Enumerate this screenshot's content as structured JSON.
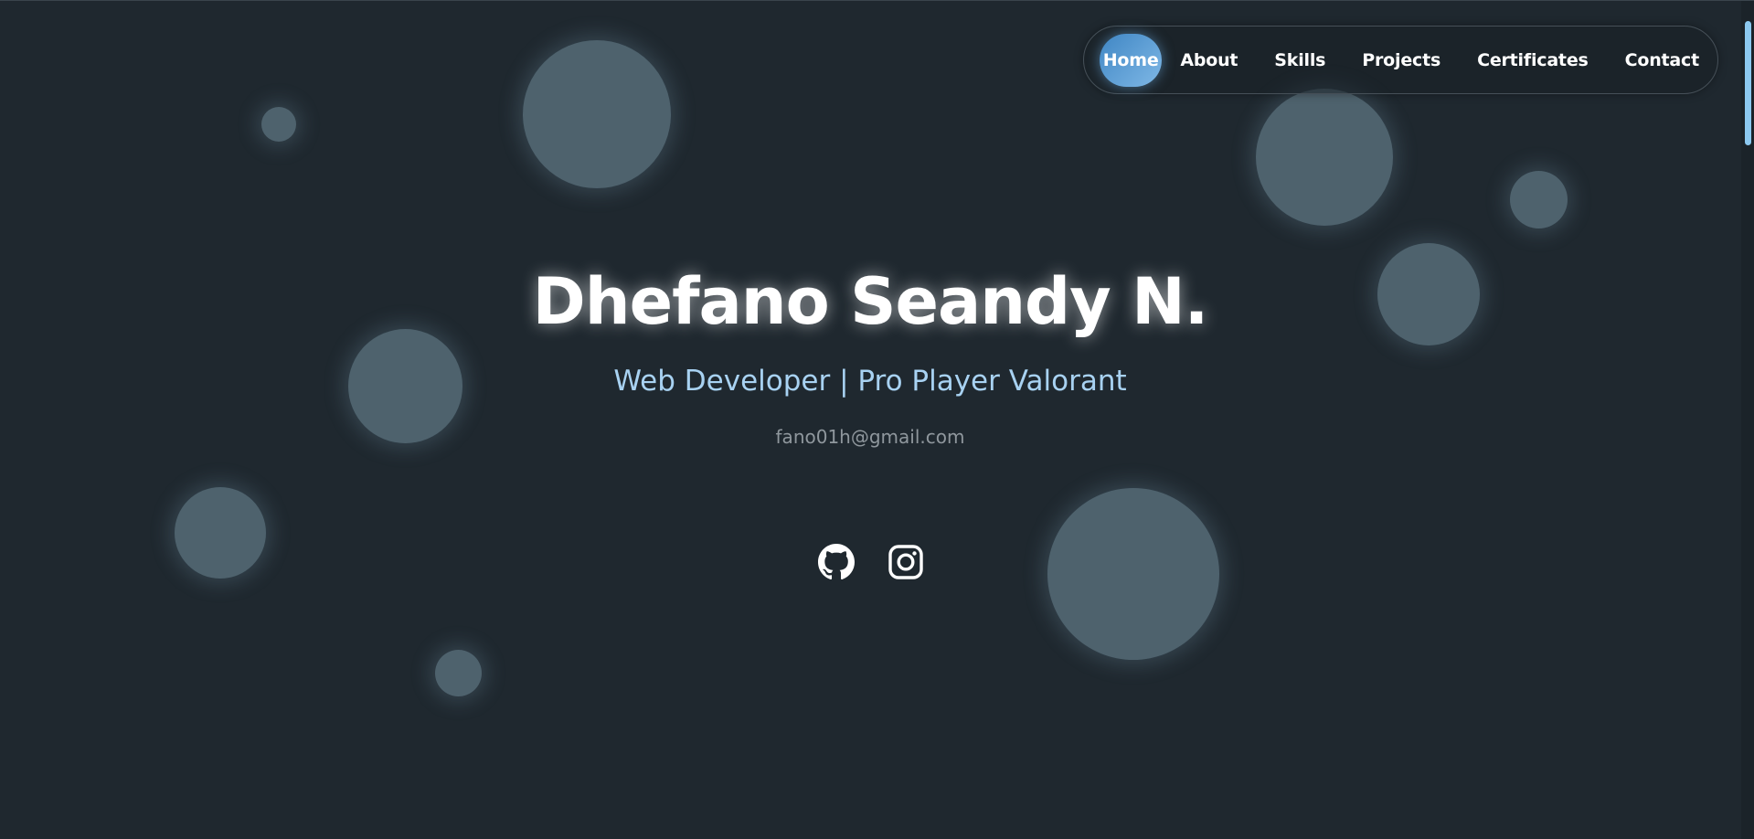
{
  "nav": {
    "items": [
      {
        "label": "Home",
        "active": true
      },
      {
        "label": "About",
        "active": false
      },
      {
        "label": "Skills",
        "active": false
      },
      {
        "label": "Projects",
        "active": false
      },
      {
        "label": "Certificates",
        "active": false
      },
      {
        "label": "Contact",
        "active": false
      }
    ]
  },
  "hero": {
    "name": "Dhefano Seandy N.",
    "role": "Web Developer | Pro Player Valorant",
    "email": "fano01h@gmail.com"
  },
  "socials": [
    {
      "icon": "github-icon"
    },
    {
      "icon": "instagram-icon"
    }
  ],
  "colors": {
    "background": "#1f282f",
    "bubble": "#4e626d",
    "accent": "#7fb8e6",
    "role_text": "#a8d2f2",
    "email_text": "#8f979d"
  }
}
